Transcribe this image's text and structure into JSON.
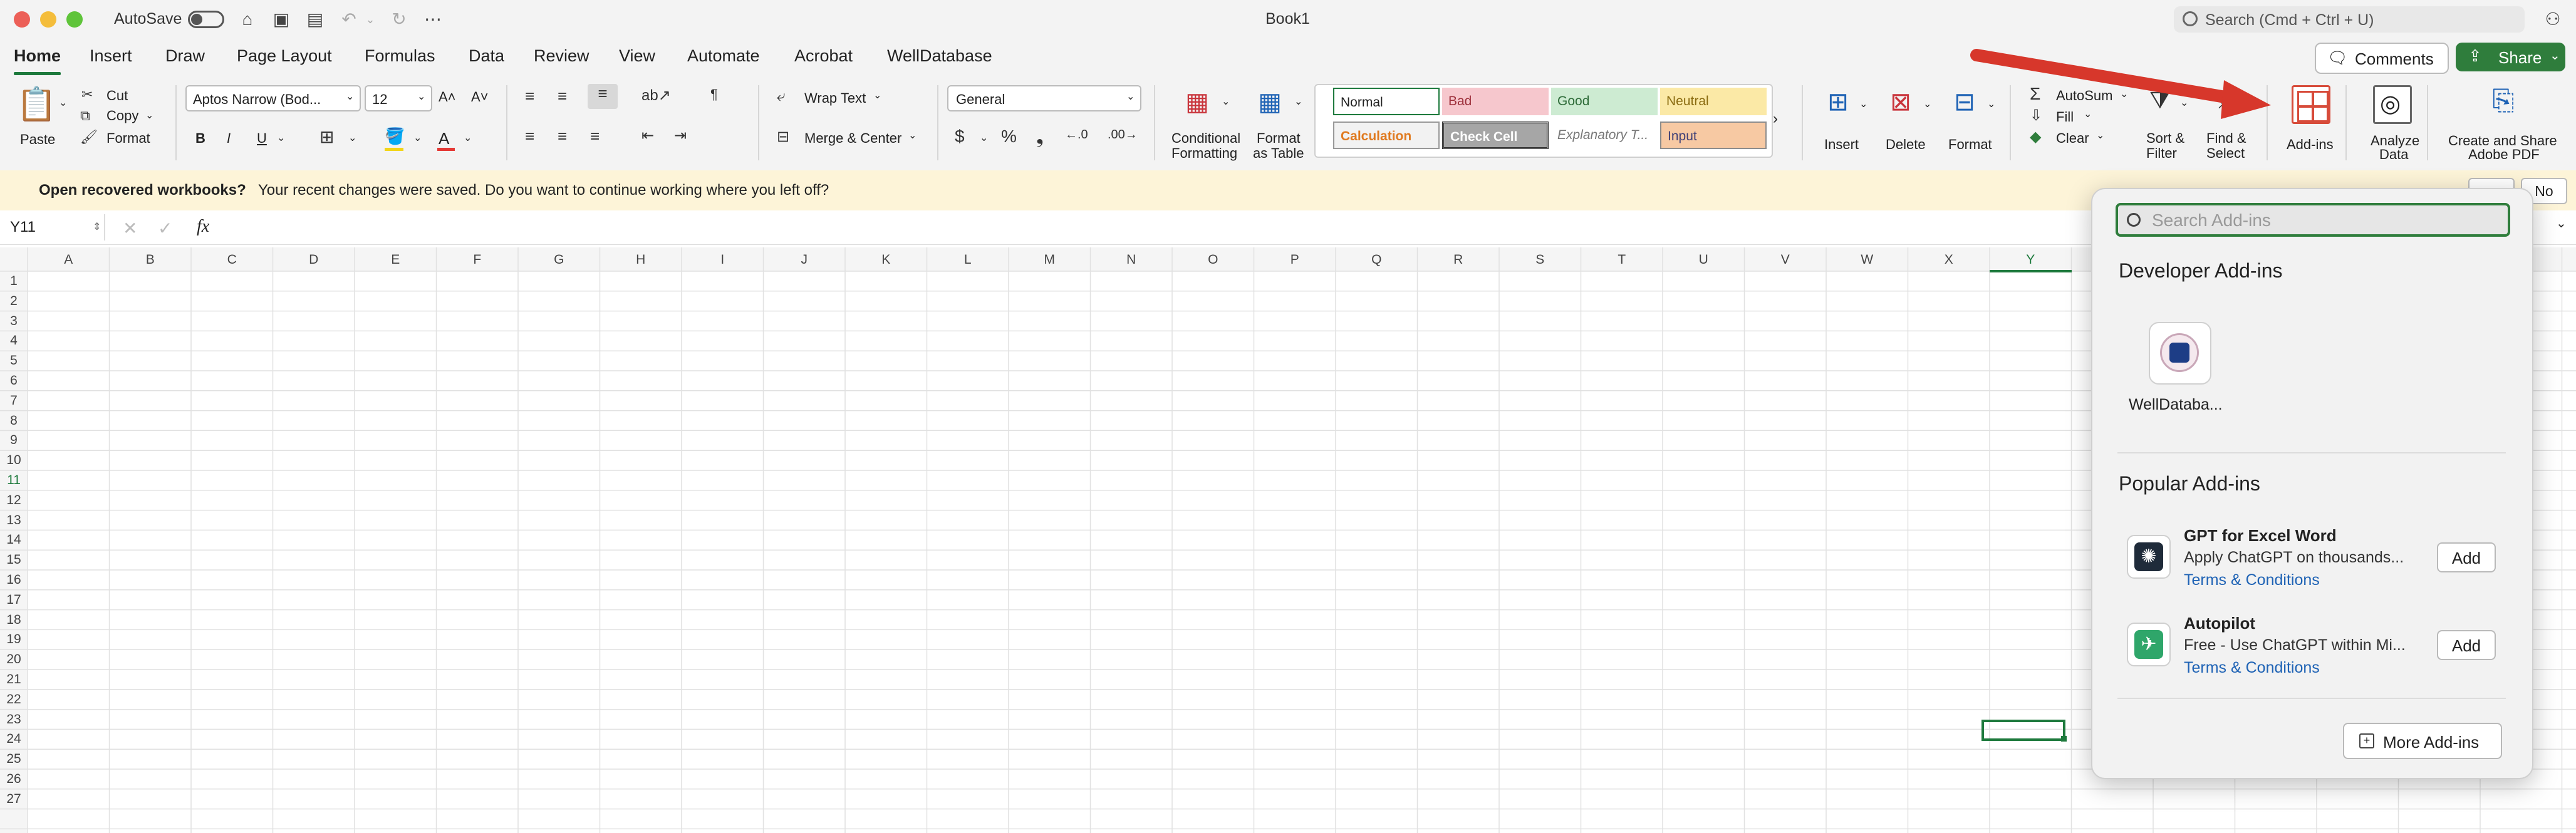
{
  "window": {
    "title": "Book1",
    "autosave_label": "AutoSave",
    "search_placeholder": "Search (Cmd + Ctrl + U)"
  },
  "tabs": [
    {
      "label": "Home"
    },
    {
      "label": "Insert"
    },
    {
      "label": "Draw"
    },
    {
      "label": "Page Layout"
    },
    {
      "label": "Formulas"
    },
    {
      "label": "Data"
    },
    {
      "label": "Review"
    },
    {
      "label": "View"
    },
    {
      "label": "Automate"
    },
    {
      "label": "Acrobat"
    },
    {
      "label": "WellDatabase"
    }
  ],
  "header_buttons": {
    "comments": "Comments",
    "share": "Share"
  },
  "ribbon": {
    "paste": "Paste",
    "cut": "Cut",
    "copy": "Copy",
    "format": "Format",
    "font_name": "Aptos Narrow (Bod...",
    "font_size": "12",
    "bold": "B",
    "italic": "I",
    "underline": "U",
    "wrap_text": "Wrap Text",
    "merge_center": "Merge & Center",
    "number_format": "General",
    "conditional_formatting": [
      "Conditional",
      "Formatting"
    ],
    "format_as_table": [
      "Format",
      "as Table"
    ],
    "styles": [
      {
        "label": "Normal",
        "bg": "#ffffff",
        "fg": "#222222"
      },
      {
        "label": "Bad",
        "bg": "#f6c7cd",
        "fg": "#9c2f3a"
      },
      {
        "label": "Good",
        "bg": "#cdebd2",
        "fg": "#2d6b38"
      },
      {
        "label": "Neutral",
        "bg": "#fbe9a6",
        "fg": "#8a6b10"
      },
      {
        "label": "Calculation",
        "bg": "#f2f2f2",
        "fg": "#e07a1f"
      },
      {
        "label": "Check Cell",
        "bg": "#a6a6a6",
        "fg": "#ffffff"
      },
      {
        "label": "Explanatory T...",
        "bg": "#ffffff",
        "fg": "#777777"
      },
      {
        "label": "Input",
        "bg": "#f7c9a3",
        "fg": "#3f3f76"
      }
    ],
    "insert": "Insert",
    "delete": "Delete",
    "format_cells": "Format",
    "autosum": "AutoSum",
    "fill": "Fill",
    "clear": "Clear",
    "sort_filter": [
      "Sort &",
      "Filter"
    ],
    "find_select": [
      "Find &",
      "Select"
    ],
    "addins": "Add-ins",
    "analyze_data": [
      "Analyze",
      "Data"
    ],
    "create_share_pdf": [
      "Create and Share",
      "Adobe PDF"
    ]
  },
  "message_bar": {
    "title": "Open recovered workbooks?",
    "body": "Your recent changes were saved. Do you want to continue working where you left off?",
    "no": "No"
  },
  "formula_bar": {
    "name_box": "Y11",
    "fx": "fx"
  },
  "grid": {
    "columns": [
      "A",
      "B",
      "C",
      "D",
      "E",
      "F",
      "G",
      "H",
      "I",
      "J",
      "K",
      "L",
      "M",
      "N",
      "O",
      "P",
      "Q",
      "R",
      "S",
      "T",
      "U",
      "V",
      "W",
      "X",
      "Y"
    ],
    "rows": [
      "1",
      "2",
      "3",
      "4",
      "5",
      "6",
      "7",
      "8",
      "9",
      "10",
      "11",
      "12",
      "13",
      "14",
      "15",
      "16",
      "17",
      "18",
      "19",
      "20",
      "21",
      "22",
      "23",
      "24",
      "25",
      "26",
      "27"
    ],
    "selected_cell": "Y11"
  },
  "addins_popup": {
    "search_placeholder": "Search Add-ins",
    "developer_heading": "Developer Add-ins",
    "developer_app": "WellDataba...",
    "popular_heading": "Popular Add-ins",
    "popular": [
      {
        "title": "GPT for Excel Word",
        "desc": "Apply ChatGPT on thousands...",
        "link": "Terms & Conditions",
        "button": "Add"
      },
      {
        "title": "Autopilot",
        "desc": "Free - Use ChatGPT within Mi...",
        "link": "Terms & Conditions",
        "button": "Add"
      }
    ],
    "more_button": "More Add-ins"
  },
  "colors": {
    "accent_green": "#1e7a3d",
    "annotation_arrow": "#d7372b",
    "link_blue": "#1f63b5",
    "message_bar_bg": "#fdf4d8"
  }
}
